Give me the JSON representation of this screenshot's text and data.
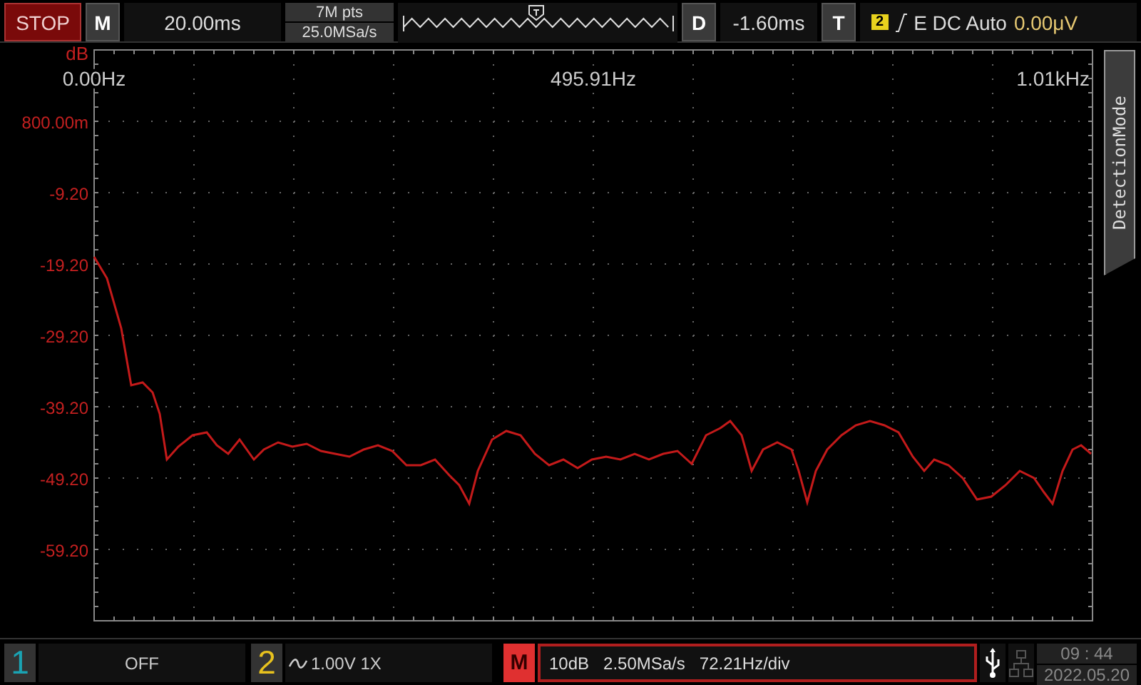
{
  "status": {
    "run_state": "STOP"
  },
  "top_bar": {
    "menu_key": "M",
    "timebase": "20.00ms",
    "memory_depth": "7M pts",
    "sample_rate": "25.0MSa/s",
    "delay_key": "D",
    "delay": "-1.60ms",
    "trigger_key": "T",
    "trigger": {
      "source": "2",
      "coupling": "E DC Auto",
      "level": "0.00μV"
    }
  },
  "side_tab": {
    "label": "DetectionMode"
  },
  "chart": {
    "x_end_label": "1.01kHz",
    "y_top_label": "800.00m",
    "chart_data": {
      "type": "line",
      "ylabel": "dB",
      "xlim": [
        0,
        991.82
      ],
      "ylim": [
        -69.2,
        10.8
      ],
      "grid": true,
      "xticks": [
        {
          "value": 0,
          "label": "0.00Hz"
        },
        {
          "value": 495.91,
          "label": "495.91Hz"
        }
      ],
      "yticks": [
        {
          "value": -9.2,
          "label": "-9.20"
        },
        {
          "value": -19.2,
          "label": "-19.20"
        },
        {
          "value": -29.2,
          "label": "-29.20"
        },
        {
          "value": -39.2,
          "label": "-39.20"
        },
        {
          "value": -49.2,
          "label": "-49.20"
        },
        {
          "value": -59.2,
          "label": "-59.20"
        }
      ],
      "x": [
        0,
        12.8,
        26.9,
        36.8,
        48.2,
        58.1,
        65.2,
        72.3,
        83.6,
        97.8,
        111.9,
        121.9,
        133.2,
        144.5,
        158.7,
        168.6,
        182.8,
        196.9,
        211.1,
        225.3,
        239.5,
        253.6,
        267.8,
        282.0,
        296.1,
        310.3,
        324.5,
        338.6,
        352.8,
        362.7,
        372.6,
        381.1,
        395.3,
        409.5,
        423.7,
        437.8,
        452.0,
        466.2,
        480.3,
        494.5,
        508.7,
        522.8,
        537.0,
        551.2,
        565.3,
        579.5,
        593.7,
        607.9,
        622.0,
        631.9,
        643.3,
        653.2,
        664.5,
        678.7,
        692.9,
        700.0,
        708.4,
        716.9,
        728.3,
        742.4,
        756.6,
        770.8,
        785.0,
        799.1,
        813.3,
        824.6,
        834.5,
        848.7,
        862.9,
        877.0,
        891.2,
        905.4,
        919.6,
        933.7,
        943.7,
        952.2,
        962.1,
        972.0,
        980.5,
        990.4
      ],
      "series": [
        {
          "color": "#c41a1a",
          "values": [
            -18.2,
            -21.2,
            -28.2,
            -36.2,
            -35.8,
            -37.2,
            -40.2,
            -46.6,
            -44.8,
            -43.2,
            -42.8,
            -44.6,
            -45.8,
            -43.8,
            -46.6,
            -45.2,
            -44.2,
            -44.8,
            -44.4,
            -45.4,
            -45.8,
            -46.2,
            -45.2,
            -44.6,
            -45.4,
            -47.4,
            -47.4,
            -46.6,
            -48.8,
            -50.2,
            -52.8,
            -48.2,
            -43.8,
            -42.6,
            -43.2,
            -45.8,
            -47.4,
            -46.6,
            -47.8,
            -46.6,
            -46.2,
            -46.6,
            -45.8,
            -46.6,
            -45.8,
            -45.4,
            -47.2,
            -43.2,
            -42.2,
            -41.2,
            -43.2,
            -48.2,
            -45.2,
            -44.2,
            -45.2,
            -48.2,
            -52.6,
            -48.2,
            -45.2,
            -43.2,
            -41.8,
            -41.2,
            -41.8,
            -42.8,
            -46.2,
            -48.2,
            -46.6,
            -47.4,
            -49.2,
            -52.2,
            -51.8,
            -50.2,
            -48.2,
            -49.2,
            -51.2,
            -52.8,
            -48.2,
            -45.2,
            -44.6,
            -45.8
          ]
        }
      ]
    }
  },
  "channels": [
    {
      "number": "1",
      "color": "#1aa3b3",
      "status": "OFF"
    },
    {
      "number": "2",
      "color": "#e8c21e",
      "status": "1.00V 1X",
      "ac_coupled": true
    }
  ],
  "math": {
    "key": "M",
    "settings": [
      "10dB",
      "2.50MSa/s",
      "72.21Hz/div"
    ]
  },
  "clock": {
    "time": "09 : 44",
    "date": "2022.05.20"
  }
}
